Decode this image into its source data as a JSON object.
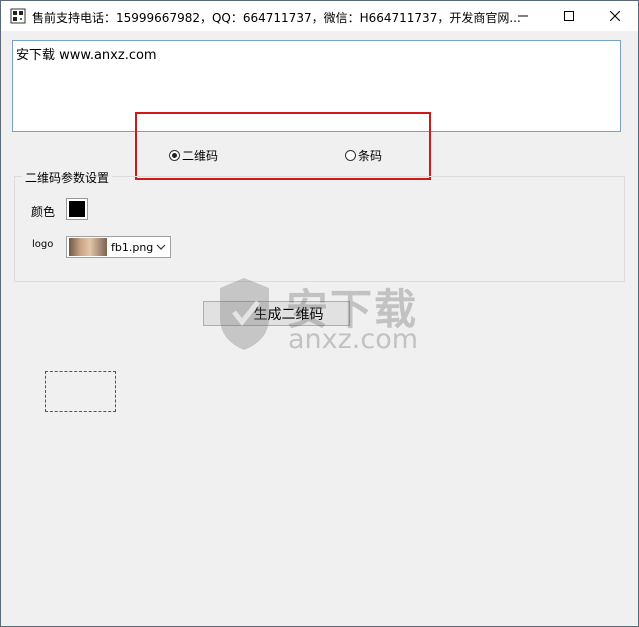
{
  "window": {
    "title": "售前支持电话：15999667982，QQ：664711737，微信：H664711737，开发商官网..."
  },
  "content": {
    "text_value": "安下载 www.anxz.com"
  },
  "mode": {
    "options": [
      {
        "label": "二维码",
        "selected": true
      },
      {
        "label": "条码",
        "selected": false
      }
    ]
  },
  "settings": {
    "group_title": "二维码参数设置",
    "color_label": "颜色",
    "color_value": "#000000",
    "logo_label": "logo",
    "logo_selected": "fb1.png"
  },
  "actions": {
    "generate_label": "生成二维码"
  },
  "watermark": {
    "big": "安下载",
    "small": "anxz.com"
  },
  "colors": {
    "highlight_frame": "#d01818",
    "textbox_border": "#7aa0c4"
  }
}
